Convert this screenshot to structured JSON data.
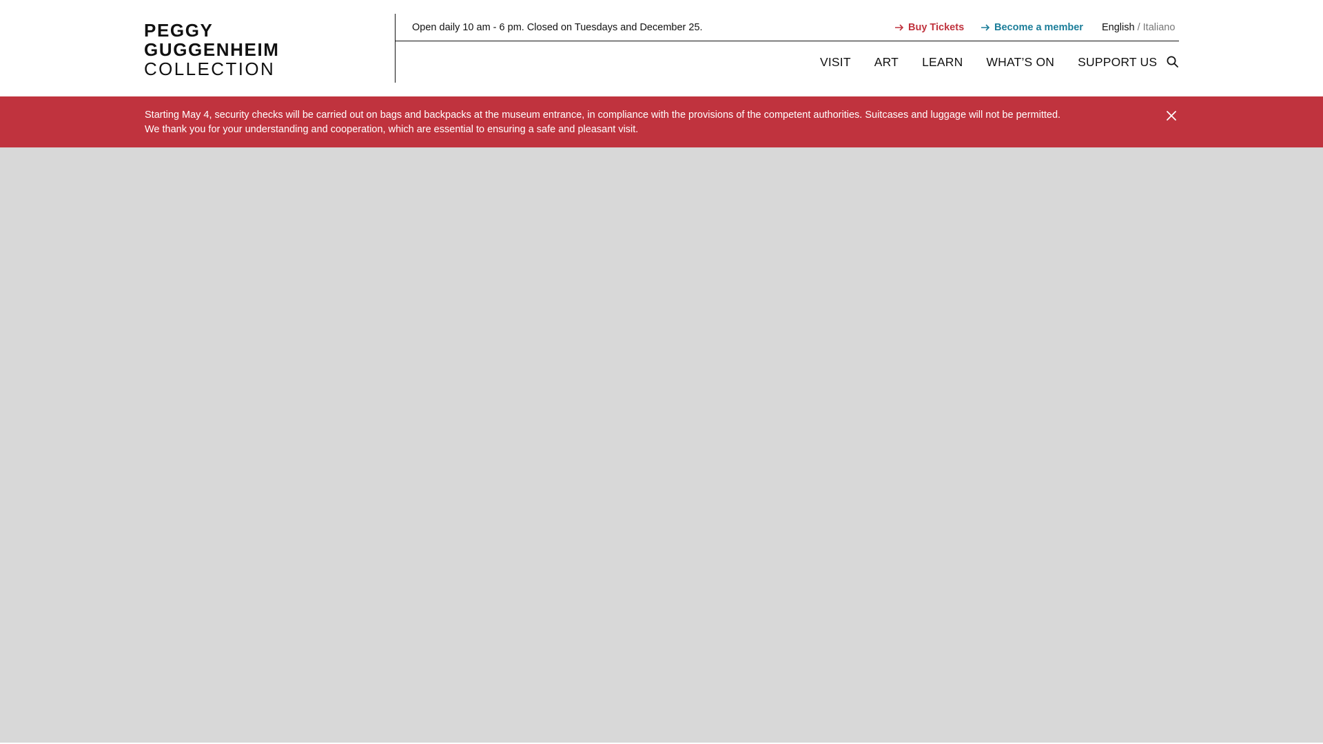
{
  "logo": {
    "line1": "PEGGY",
    "line2": "GUGGENHEIM",
    "line3": "COLLECTION"
  },
  "topbar": {
    "hours": "Open daily 10 am - 6 pm. Closed on Tuesdays and December 25.",
    "buy_tickets": "Buy Tickets",
    "become_member": "Become a member",
    "lang_active": "English",
    "lang_separator": "/",
    "lang_other": "Italiano"
  },
  "nav": {
    "items": [
      "VISIT",
      "ART",
      "LEARN",
      "WHAT’S ON",
      "SUPPORT US"
    ]
  },
  "alert": {
    "line1": "Starting May 4, security checks will be carried out on bags and backpacks at the museum entrance, in compliance with the provisions of the competent authorities. Suitcases and luggage will not be permitted.",
    "line2": "We thank you for your understanding and cooperation, which are essential to ensuring a safe and pleasant visit."
  },
  "icons": {
    "tickets_arrow": "arrow-right-icon",
    "member_arrow": "arrow-right-icon",
    "search": "search-icon",
    "close": "close-icon"
  },
  "colors": {
    "brand_red": "#c0333e",
    "member_teal": "#1b7d99",
    "hero_placeholder": "#d8d8d8",
    "text": "#111111",
    "muted": "#777777"
  }
}
